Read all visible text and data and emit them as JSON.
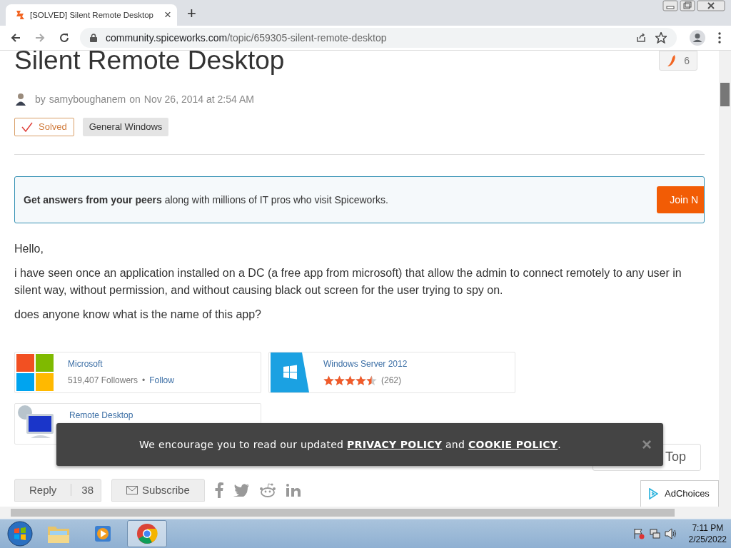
{
  "browser": {
    "tab": {
      "title": "[SOLVED] Silent Remote Desktop",
      "close": "×"
    },
    "new_tab": "+",
    "url_host": "community.spiceworks.com",
    "url_path": "/topic/659305-silent-remote-desktop"
  },
  "article": {
    "title": "Silent Remote Desktop",
    "by": "by",
    "author": "samyboughanem",
    "on": "on",
    "date": "Nov 26, 2014 at 2:54 AM",
    "pepper_count": "6",
    "tags": [
      {
        "label": "Solved",
        "kind": "solved"
      },
      {
        "label": "General Windows",
        "kind": "category"
      }
    ]
  },
  "promo": {
    "text": "**Get answers from your peers** along with millions of IT pros who visit Spiceworks.",
    "button": "Join N"
  },
  "body": [
    "Hello,",
    "i have seen once an application installed on a DC (a free app from microsoft) that allow the admin to connect remotely to any user in silent way, without permission, and without causing black out screen for the user trying to spy on.",
    "does anyone know what is the name of this app?"
  ],
  "products": [
    {
      "kind": "vendor",
      "name": "Microsoft",
      "followers": "519,407 Followers",
      "separator": "•",
      "follow": "Follow"
    },
    {
      "kind": "product",
      "name": "Windows Server 2012",
      "stars": 4.5,
      "count": "(262)"
    },
    {
      "kind": "software",
      "name": "Remote Desktop"
    }
  ],
  "cookie_banner": {
    "before": "We encourage you to read our updated",
    "privacy": "PRIVACY POLICY",
    "middle": "and",
    "cookie": "COOKIE POLICY",
    "after": ".",
    "close": "×"
  },
  "back_to_top": "Top",
  "adchoices": "AdChoices",
  "actions": {
    "reply": "Reply",
    "reply_count": "38",
    "subscribe": "Subscribe"
  },
  "taskbar": {
    "apps": [
      {
        "kind": "explorer",
        "selected": false
      },
      {
        "kind": "media",
        "selected": false
      },
      {
        "kind": "chrome",
        "selected": true
      }
    ],
    "time": "7:11 PM",
    "date": "2/25/2022"
  }
}
